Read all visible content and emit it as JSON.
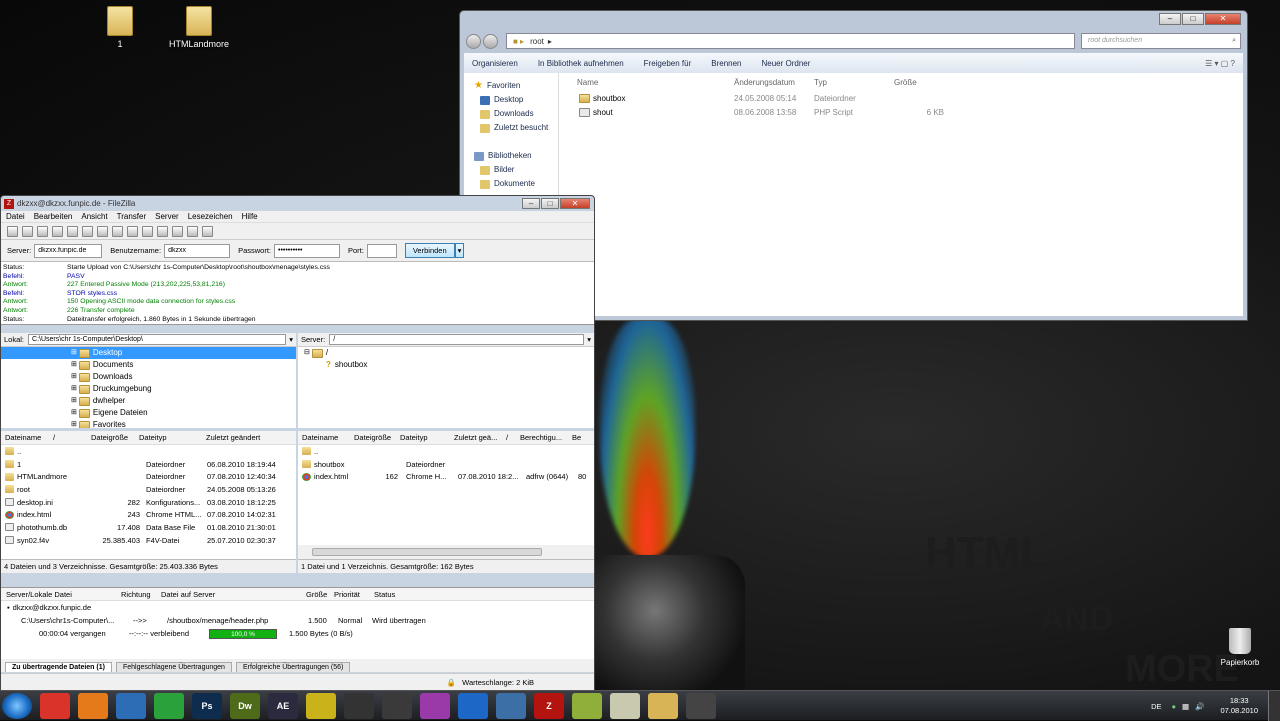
{
  "desktop": {
    "icons": [
      {
        "label": "1"
      },
      {
        "label": "HTMLandmore"
      }
    ],
    "trash_label": "Papierkorb",
    "watermark": [
      "HTML",
      "AND",
      "MORE"
    ]
  },
  "explorer": {
    "address": "root",
    "search_placeholder": "root durchsuchen",
    "commands": [
      "Organisieren",
      "In Bibliothek aufnehmen",
      "Freigeben für",
      "Brennen",
      "Neuer Ordner"
    ],
    "nav": [
      {
        "label": "Favoriten",
        "icon": "star-icon"
      },
      {
        "label": "Desktop",
        "icon": "desktop-icon"
      },
      {
        "label": "Downloads",
        "icon": "downloads-icon"
      },
      {
        "label": "Zuletzt besucht",
        "icon": "recent-icon"
      },
      {
        "label": "Bibliotheken",
        "icon": "library-icon"
      },
      {
        "label": "Bilder",
        "icon": "pictures-icon"
      },
      {
        "label": "Dokumente",
        "icon": "documents-icon"
      }
    ],
    "columns": [
      "Name",
      "Änderungsdatum",
      "Typ",
      "Größe"
    ],
    "files": [
      {
        "name": "shoutbox",
        "date": "24.05.2008 05:14",
        "type": "Dateiordner",
        "size": ""
      },
      {
        "name": "shout",
        "date": "08.06.2008 13:58",
        "type": "PHP Script",
        "size": "6 KB"
      }
    ]
  },
  "filezilla": {
    "title": "dkzxx@dkzxx.funpic.de - FileZilla",
    "menu": [
      "Datei",
      "Bearbeiten",
      "Ansicht",
      "Transfer",
      "Server",
      "Lesezeichen",
      "Hilfe"
    ],
    "quickconnect": {
      "server_label": "Server:",
      "server": "dkzxx.funpic.de",
      "user_label": "Benutzername:",
      "user": "dkzxx",
      "pass_label": "Passwort:",
      "pass": "••••••••••",
      "port_label": "Port:",
      "port": "",
      "connect": "Verbinden"
    },
    "log": [
      {
        "k": "Status:",
        "v": "Starte Upload von C:\\Users\\chr 1s-Computer\\Desktop\\root\\shoutbox\\menage\\styles.css",
        "c": ""
      },
      {
        "k": "Befehl:",
        "v": "PASV",
        "c": "blue"
      },
      {
        "k": "Antwort:",
        "v": "227 Entered Passive Mode (213,202,225,53,81,216)",
        "c": "green"
      },
      {
        "k": "Befehl:",
        "v": "STOR styles.css",
        "c": "blue"
      },
      {
        "k": "Antwort:",
        "v": "150 Opening ASCII mode data connection for styles.css",
        "c": "green"
      },
      {
        "k": "Antwort:",
        "v": "226 Transfer complete",
        "c": "green"
      },
      {
        "k": "Status:",
        "v": "Dateitransfer erfolgreich, 1.860 Bytes in 1 Sekunde übertragen",
        "c": ""
      }
    ],
    "local": {
      "label": "Lokal:",
      "path": "C:\\Users\\chr 1s-Computer\\Desktop\\",
      "tree": [
        "Desktop",
        "Documents",
        "Downloads",
        "Druckumgebung",
        "dwhelper",
        "Eigene Dateien",
        "Favorites"
      ],
      "columns": [
        "Dateiname",
        "/",
        "Dateigröße",
        "Dateityp",
        "Zuletzt geändert"
      ],
      "files": [
        {
          "name": "..",
          "size": "",
          "type": "",
          "date": "",
          "icon": "f"
        },
        {
          "name": "1",
          "size": "",
          "type": "Dateiordner",
          "date": "06.08.2010 18:19:44",
          "icon": "f"
        },
        {
          "name": "HTMLandmore",
          "size": "",
          "type": "Dateiordner",
          "date": "07.08.2010 12:40:34",
          "icon": "f"
        },
        {
          "name": "root",
          "size": "",
          "type": "Dateiordner",
          "date": "24.05.2008 05:13:26",
          "icon": "f"
        },
        {
          "name": "desktop.ini",
          "size": "282",
          "type": "Konfigurations...",
          "date": "03.08.2010 18:12:25",
          "icon": "d"
        },
        {
          "name": "index.html",
          "size": "243",
          "type": "Chrome HTML...",
          "date": "07.08.2010 14:02:31",
          "icon": "c"
        },
        {
          "name": "photothumb.db",
          "size": "17.408",
          "type": "Data Base File",
          "date": "01.08.2010 21:30:01",
          "icon": "d"
        },
        {
          "name": "syn02.f4v",
          "size": "25.385.403",
          "type": "F4V-Datei",
          "date": "25.07.2010 02:30:37",
          "icon": "d"
        }
      ],
      "status": "4 Dateien und 3 Verzeichnisse. Gesamtgröße: 25.403.336 Bytes"
    },
    "remote": {
      "label": "Server:",
      "path": "/",
      "tree": [
        "/",
        "shoutbox"
      ],
      "columns": [
        "Dateiname",
        "Dateigröße",
        "Dateityp",
        "Zuletzt geä...",
        "/",
        "Berechtigu...",
        "Be"
      ],
      "files": [
        {
          "name": "..",
          "size": "",
          "type": "",
          "date": "",
          "perm": "",
          "own": "",
          "icon": "f"
        },
        {
          "name": "shoutbox",
          "size": "",
          "type": "Dateiordner",
          "date": "",
          "perm": "",
          "own": "",
          "icon": "f"
        },
        {
          "name": "index.html",
          "size": "162",
          "type": "Chrome H...",
          "date": "07.08.2010 18:2...",
          "perm": "adfrw (0644)",
          "own": "80",
          "icon": "c"
        }
      ],
      "status": "1 Datei und 1 Verzeichnis. Gesamtgröße: 162 Bytes"
    },
    "queue": {
      "columns": [
        "Server/Lokale Datei",
        "Richtung",
        "Datei auf Server",
        "Größe",
        "Priorität",
        "Status"
      ],
      "server": "dkzxx@dkzxx.funpic.de",
      "local_file": "C:\\Users\\chr1s-Computer\\...",
      "direction": "-->>",
      "remote_file": "/shoutbox/menage/header.php",
      "size": "1.500",
      "priority": "Normal",
      "status": "Wird übertragen",
      "elapsed": "00:00:04 vergangen",
      "remaining": "--:--:-- verbleibend",
      "progress_pct": 100,
      "progress_label": "100,0 %",
      "rate": "1.500 Bytes (0 B/s)"
    },
    "tabs": [
      "Zu übertragende Dateien (1)",
      "Fehlgeschlagene Übertragungen",
      "Erfolgreiche Übertragungen (56)"
    ],
    "queue_status": "Warteschlange: 2 KiB"
  },
  "taskbar": {
    "apps": [
      {
        "name": "chrome-icon",
        "label": "",
        "color": "#d9332a"
      },
      {
        "name": "firefox-icon",
        "label": "",
        "color": "#e57a1a"
      },
      {
        "name": "thunderbird-icon",
        "label": "",
        "color": "#2d6db5"
      },
      {
        "name": "flower-icon",
        "label": "",
        "color": "#2aa13a"
      },
      {
        "name": "photoshop-icon",
        "label": "Ps",
        "color": "#0d2c4e"
      },
      {
        "name": "dreamweaver-icon",
        "label": "Dw",
        "color": "#4e6b1a"
      },
      {
        "name": "aftereffects-icon",
        "label": "AE",
        "color": "#2b2a3f"
      },
      {
        "name": "app-icon",
        "label": "",
        "color": "#c9b21a"
      },
      {
        "name": "winamp-icon",
        "label": "",
        "color": "#333"
      },
      {
        "name": "skype-icon",
        "label": "",
        "color": "#3a3a3a"
      },
      {
        "name": "itunes-icon",
        "label": "",
        "color": "#9a3aa8"
      },
      {
        "name": "bolt-icon",
        "label": "",
        "color": "#1d68c7"
      },
      {
        "name": "network-icon",
        "label": "",
        "color": "#3b6fa5"
      },
      {
        "name": "filezilla-icon",
        "label": "Z",
        "color": "#b3140f"
      },
      {
        "name": "notes-icon",
        "label": "",
        "color": "#8fae3a"
      },
      {
        "name": "notepad-icon",
        "label": "",
        "color": "#c9c9b0"
      },
      {
        "name": "explorer-icon",
        "label": "",
        "color": "#d9b457"
      },
      {
        "name": "app2-icon",
        "label": "",
        "color": "#444"
      }
    ],
    "lang": "DE",
    "time": "18:33",
    "date": "07.08.2010"
  }
}
